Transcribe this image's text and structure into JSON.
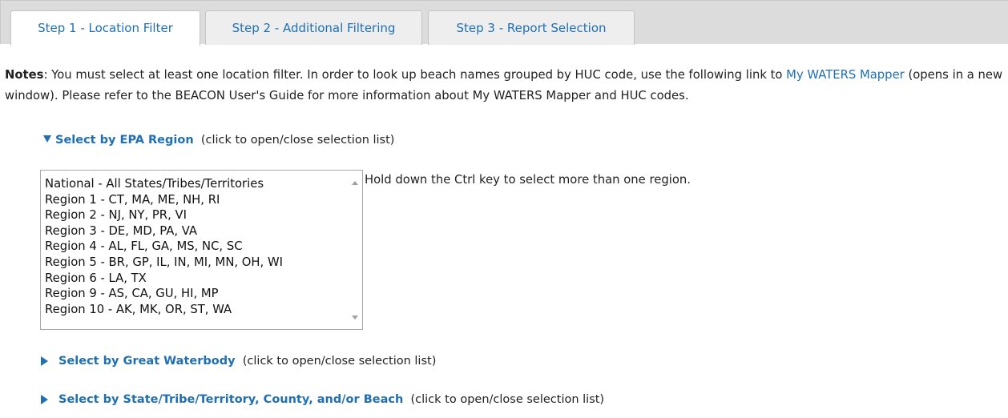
{
  "tabs": [
    {
      "label": "Step 1 - Location Filter",
      "active": true
    },
    {
      "label": "Step 2 - Additional Filtering",
      "active": false
    },
    {
      "label": "Step 3 - Report Selection",
      "active": false
    }
  ],
  "notes": {
    "label": "Notes",
    "text_before_link": ": You must select at least one location filter. In order to look up beach names grouped by HUC code, use the following link to ",
    "link": "My WATERS Mapper",
    "text_after_link": " (opens in a new window). Please refer to the BEACON User's Guide for more information about My WATERS Mapper and HUC codes."
  },
  "sections": {
    "epa_region": {
      "title": "Select by EPA Region",
      "hint": "(click to open/close selection list)",
      "expanded": true,
      "options": [
        "National - All States/Tribes/Territories",
        "Region 1 - CT, MA, ME, NH, RI",
        "Region 2 - NJ, NY, PR, VI",
        "Region 3 - DE, MD, PA, VA",
        "Region 4 - AL, FL, GA, MS, NC, SC",
        "Region 5 - BR, GP, IL, IN, MI, MN, OH, WI",
        "Region 6 - LA, TX",
        "Region 9 - AS, CA, GU, HI, MP",
        "Region 10 - AK, MK, OR, ST, WA"
      ],
      "ctrl_hint": "Hold down the Ctrl key to select more than one region."
    },
    "great_waterbody": {
      "title": "Select by Great Waterbody",
      "hint": "(click to open/close selection list)",
      "expanded": false
    },
    "state_tribe": {
      "title": "Select by State/Tribe/Territory, County, and/or Beach",
      "hint": "(click to open/close selection list)",
      "expanded": false
    }
  },
  "colors": {
    "link": "#1f6fb5",
    "tabbar_background": "#dcdcdc"
  }
}
